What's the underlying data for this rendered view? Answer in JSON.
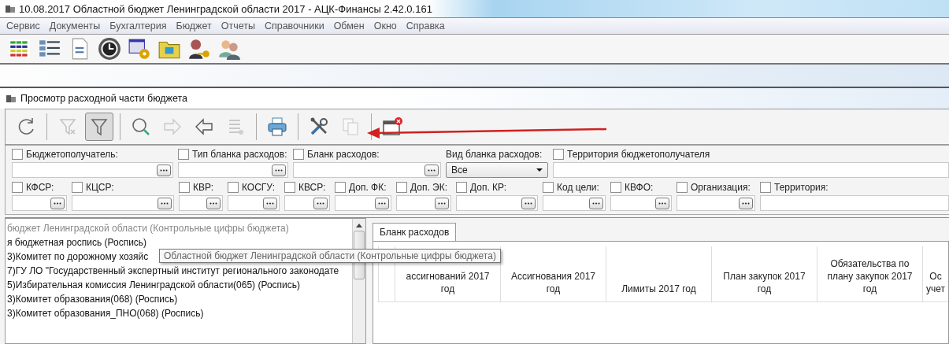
{
  "window": {
    "title": "10.08.2017 Областной бюджет Ленинградской области 2017 - АЦК-Финансы 2.42.0.161"
  },
  "menu": [
    "Сервис",
    "Документы",
    "Бухгалтерия",
    "Бюджет",
    "Отчеты",
    "Справочники",
    "Обмен",
    "Окно",
    "Справка"
  ],
  "child_window": {
    "title": "Просмотр расходной части бюджета"
  },
  "toolbar": [
    {
      "disabled": false,
      "pressed": false
    },
    {
      "disabled": true,
      "pressed": false
    },
    {
      "disabled": false,
      "pressed": true
    },
    {
      "disabled": false,
      "pressed": false
    },
    {
      "disabled": true,
      "pressed": false
    },
    {
      "disabled": false,
      "pressed": false
    },
    {
      "disabled": true,
      "pressed": false
    },
    {
      "disabled": false,
      "pressed": false
    },
    {
      "disabled": false,
      "pressed": false
    },
    {
      "disabled": true,
      "pressed": false
    },
    {
      "disabled": false,
      "pressed": false
    }
  ],
  "filters_row_1": [
    {
      "label": "Бюджетополучатель:",
      "checked": false,
      "kind": "browse"
    },
    {
      "label": "Тип бланка расходов:",
      "checked": false,
      "kind": "browse"
    },
    {
      "label": "Бланк расходов:",
      "checked": false,
      "kind": "browse"
    },
    {
      "label": "Вид бланка расходов:",
      "kind": "select",
      "value": "Все"
    },
    {
      "label": "Территория бюджетополучателя",
      "checked": false,
      "kind": "text"
    }
  ],
  "filters_row_2": [
    {
      "label": "КФСР:",
      "checked": false,
      "kind": "browse"
    },
    {
      "label": "КЦСР:",
      "checked": false,
      "kind": "browse"
    },
    {
      "label": "КВР:",
      "checked": false,
      "kind": "browse"
    },
    {
      "label": "КОСГУ:",
      "checked": false,
      "kind": "browse"
    },
    {
      "label": "КВСР:",
      "checked": false,
      "kind": "browse"
    },
    {
      "label": "Доп. ФК:",
      "checked": false,
      "kind": "browse"
    },
    {
      "label": "Доп. ЭК:",
      "checked": false,
      "kind": "browse"
    },
    {
      "label": "Доп. КР:",
      "checked": false,
      "kind": "browse"
    },
    {
      "label": "Код цели:",
      "checked": false,
      "kind": "browse"
    },
    {
      "label": "КВФО:",
      "checked": false,
      "kind": "browse"
    },
    {
      "label": "Организация:",
      "checked": false,
      "kind": "browse"
    },
    {
      "label": "Территория:",
      "checked": false,
      "kind": "text"
    }
  ],
  "tree": [
    {
      "label": "бюджет Ленинградской области (Контрольные цифры бюджета)",
      "greyed": true
    },
    {
      "label": "я бюджетная роспись (Роспись)",
      "greyed": false
    },
    {
      "label": "3)Комитет по дорожному хозяйс",
      "greyed": false
    },
    {
      "label": "7)ГУ ЛО \"Государственный экспертный институт регионального законодате",
      "greyed": false
    },
    {
      "label": "5)Избирательная комиссия Ленинградской области(065) (Роспись)",
      "greyed": false
    },
    {
      "label": "3)Комитет образования(068) (Роспись)",
      "greyed": false
    },
    {
      "label": "3)Комитет образования_ПНО(068) (Роспись)",
      "greyed": false
    }
  ],
  "tooltip": "Областной бюджет Ленинградской области (Контрольные цифры бюджета)",
  "tabs": [
    {
      "label": "Бланк расходов",
      "selected": true
    }
  ],
  "table": {
    "columns": [
      "ассигнований 2017 год",
      "Ассигнования 2017 год",
      "Лимиты 2017 год",
      "План закупок 2017 год",
      "Обязательства по плану закупок 2017 год",
      "Ос учет"
    ]
  }
}
